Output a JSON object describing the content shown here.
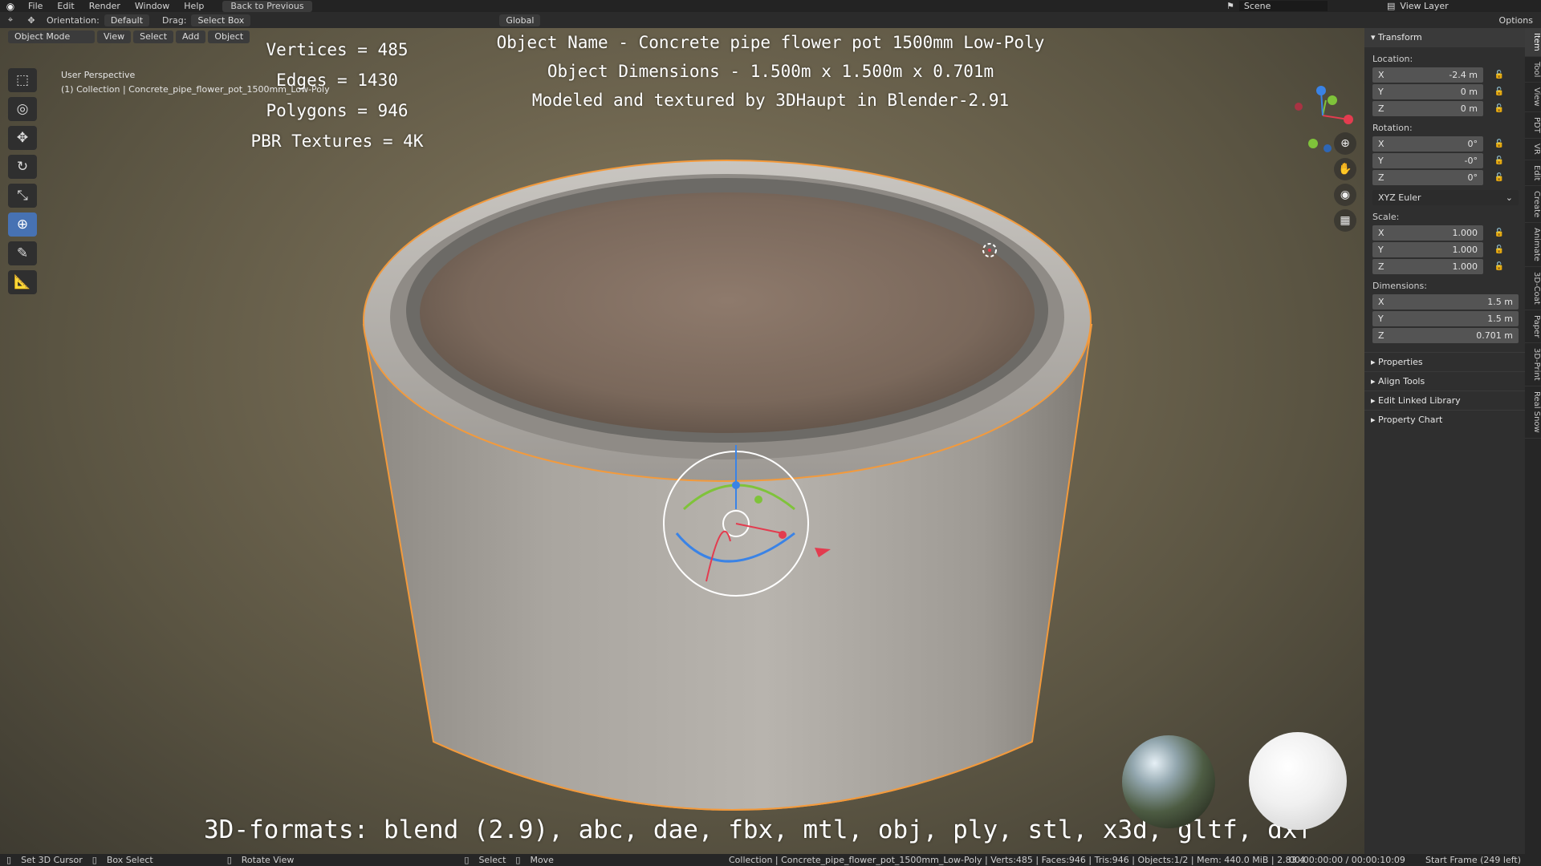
{
  "topbar": {
    "menus": [
      "File",
      "Edit",
      "Render",
      "Window",
      "Help"
    ],
    "back_label": "Back to Previous",
    "scene_label": "Scene",
    "view_layer_label": "View Layer"
  },
  "header": {
    "orientation_label": "Orientation:",
    "orientation_value": "Default",
    "drag_label": "Drag:",
    "drag_value": "Select Box",
    "transform_space": "Global",
    "options_label": "Options"
  },
  "viewport_header": {
    "mode": "Object Mode",
    "view": "View",
    "select": "Select",
    "add": "Add",
    "object": "Object"
  },
  "viewport": {
    "perspective": "User Perspective",
    "collection_info": "(1) Collection | Concrete_pipe_flower_pot_1500mm_Low-Poly"
  },
  "overlay": {
    "vertices": "Vertices = 485",
    "edges": "Edges = 1430",
    "polygons": "Polygons = 946",
    "textures": "PBR Textures = 4K",
    "object_name": "Object Name - Concrete pipe flower pot 1500mm Low-Poly",
    "dimensions": "Object Dimensions -  1.500m x 1.500m x 0.701m",
    "credit": "Modeled and textured by 3DHaupt in Blender-2.91",
    "formats": "3D-formats: blend (2.9), abc, dae, fbx, mtl, obj, ply, stl, x3d, gltf, dxf"
  },
  "panel": {
    "transform_title": "Transform",
    "location_label": "Location:",
    "location": [
      {
        "axis": "X",
        "value": "-2.4 m"
      },
      {
        "axis": "Y",
        "value": "0 m"
      },
      {
        "axis": "Z",
        "value": "0 m"
      }
    ],
    "rotation_label": "Rotation:",
    "rotation": [
      {
        "axis": "X",
        "value": "0°"
      },
      {
        "axis": "Y",
        "value": "-0°"
      },
      {
        "axis": "Z",
        "value": "0°"
      }
    ],
    "rotation_mode": "XYZ Euler",
    "scale_label": "Scale:",
    "scale": [
      {
        "axis": "X",
        "value": "1.000"
      },
      {
        "axis": "Y",
        "value": "1.000"
      },
      {
        "axis": "Z",
        "value": "1.000"
      }
    ],
    "dimensions_label": "Dimensions:",
    "dimensions": [
      {
        "axis": "X",
        "value": "1.5 m"
      },
      {
        "axis": "Y",
        "value": "1.5 m"
      },
      {
        "axis": "Z",
        "value": "0.701 m"
      }
    ],
    "collapsed": [
      "Properties",
      "Align Tools",
      "Edit Linked Library",
      "Property Chart"
    ]
  },
  "tabs": [
    "Item",
    "Tool",
    "View",
    "PDT",
    "VR",
    "Edit",
    "Create",
    "Animate",
    "3D-Coat",
    "Paper",
    "3D-Print",
    "Real Snow"
  ],
  "status": {
    "set_cursor": "Set 3D Cursor",
    "box_select": "Box Select",
    "rotate_view": "Rotate View",
    "select": "Select",
    "move": "Move",
    "info": "Collection | Concrete_pipe_flower_pot_1500mm_Low-Poly | Verts:485 | Faces:946 | Tris:946 | Objects:1/2 | Mem: 440.0 MiB | 2.83.4",
    "time": "00:00:00:00 / 00:00:10:09",
    "frame": "Start Frame (249 left)"
  },
  "colors": {
    "accent": "#4772b3",
    "selection_outline": "#f39a3c",
    "axis_x": "#e33c4f",
    "axis_y": "#7fc33a",
    "axis_z": "#3a83e6"
  }
}
